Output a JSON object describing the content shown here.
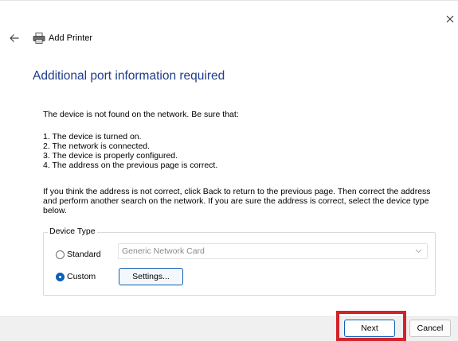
{
  "window": {
    "title": "Add Printer",
    "icons": {
      "close": "close-icon",
      "back": "back-arrow-icon",
      "printer": "printer-icon"
    }
  },
  "page": {
    "heading": "Additional port information required",
    "intro": "The device is not found on the network.  Be sure that:",
    "checklist": [
      "1.  The device is turned on.",
      "2.  The network is connected.",
      "3.  The device is properly configured.",
      "4.  The address on the previous page is correct."
    ],
    "instructions": "If you think the address is not correct, click Back to return to the previous page.  Then correct the address and perform another search on the network.  If you are sure the address is correct, select the device type below."
  },
  "device_type": {
    "group_label": "Device Type",
    "standard": {
      "label": "Standard",
      "selected": false,
      "value": "Generic Network Card"
    },
    "custom": {
      "label": "Custom",
      "selected": true,
      "settings_label": "Settings..."
    }
  },
  "footer": {
    "next_label": "Next",
    "cancel_label": "Cancel"
  },
  "colors": {
    "heading": "#1f3c8c",
    "accent": "#0d5fb8",
    "highlight": "#d2232a",
    "footer_bg": "#f0f0f0"
  }
}
